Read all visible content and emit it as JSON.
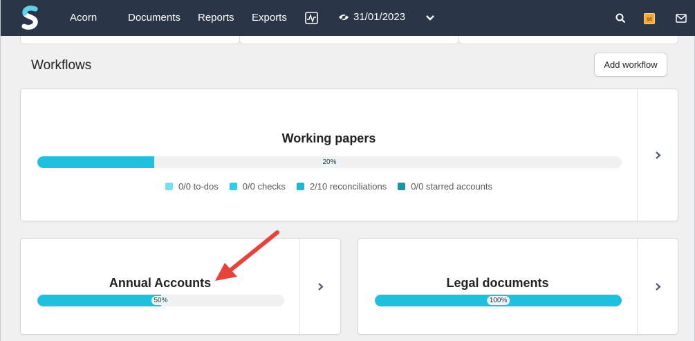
{
  "nav": {
    "company": "Acorn",
    "documents": "Documents",
    "reports": "Reports",
    "exports": "Exports",
    "date": "31/01/2023",
    "badge": "st",
    "colors": {
      "bg": "#2a3548",
      "logo": "#5fd0e8"
    },
    "icons": [
      "logo-icon",
      "activity-icon",
      "eye-icon",
      "chevron-down-icon",
      "search-icon",
      "mail-icon"
    ]
  },
  "section": {
    "title": "Workflows",
    "add_label": "Add workflow"
  },
  "cards": {
    "working_papers": {
      "title": "Working papers",
      "progress": 20,
      "progress_label": "20%",
      "legend": [
        {
          "label": "0/0 to-dos",
          "color": "#6fe3f4"
        },
        {
          "label": "0/0 checks",
          "color": "#2bd0e6"
        },
        {
          "label": "2/10 reconciliations",
          "color": "#1db8d4"
        },
        {
          "label": "0/0 starred accounts",
          "color": "#1895a6"
        }
      ]
    },
    "annual_accounts": {
      "title": "Annual Accounts",
      "progress": 50,
      "progress_label": "50%"
    },
    "legal_documents": {
      "title": "Legal documents",
      "progress": 100,
      "progress_label": "100%"
    }
  },
  "colors": {
    "progress_fill": "#1fc0dd",
    "arrow": "#e8423a"
  }
}
